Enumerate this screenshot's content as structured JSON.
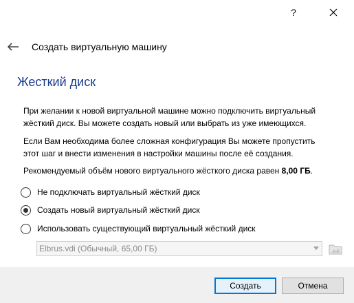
{
  "titlebar": {
    "help": "?"
  },
  "header": {
    "title": "Создать виртуальную машину"
  },
  "page": {
    "title": "Жесткий диск",
    "desc1_line1": "При желании к новой виртуальной машине можно подключить виртуальный",
    "desc1_line2": "жёсткий диск. Вы можете создать новый или выбрать из уже имеющихся.",
    "desc2_line1": "Если Вам необходима более сложная конфигурация Вы можете пропустить",
    "desc2_line2": "этот шаг и внести изменения в настройки машины после её создания.",
    "recommend_prefix": "Рекомендуемый объём нового виртуального жёсткого диска равен ",
    "recommend_value": "8,00 ГБ",
    "recommend_suffix": "."
  },
  "options": [
    {
      "label": "Не подключать виртуальный жёсткий диск",
      "checked": false
    },
    {
      "label": "Создать новый виртуальный жёсткий диск",
      "checked": true
    },
    {
      "label": "Использовать существующий виртуальный жёсткий диск",
      "checked": false
    }
  ],
  "existing_disk": {
    "selected": "Elbrus.vdi (Обычный, 65,00 ГБ)"
  },
  "buttons": {
    "create": "Создать",
    "cancel": "Отмена"
  },
  "colors": {
    "title_blue": "#1a3c8e",
    "accent": "#0078d7"
  }
}
